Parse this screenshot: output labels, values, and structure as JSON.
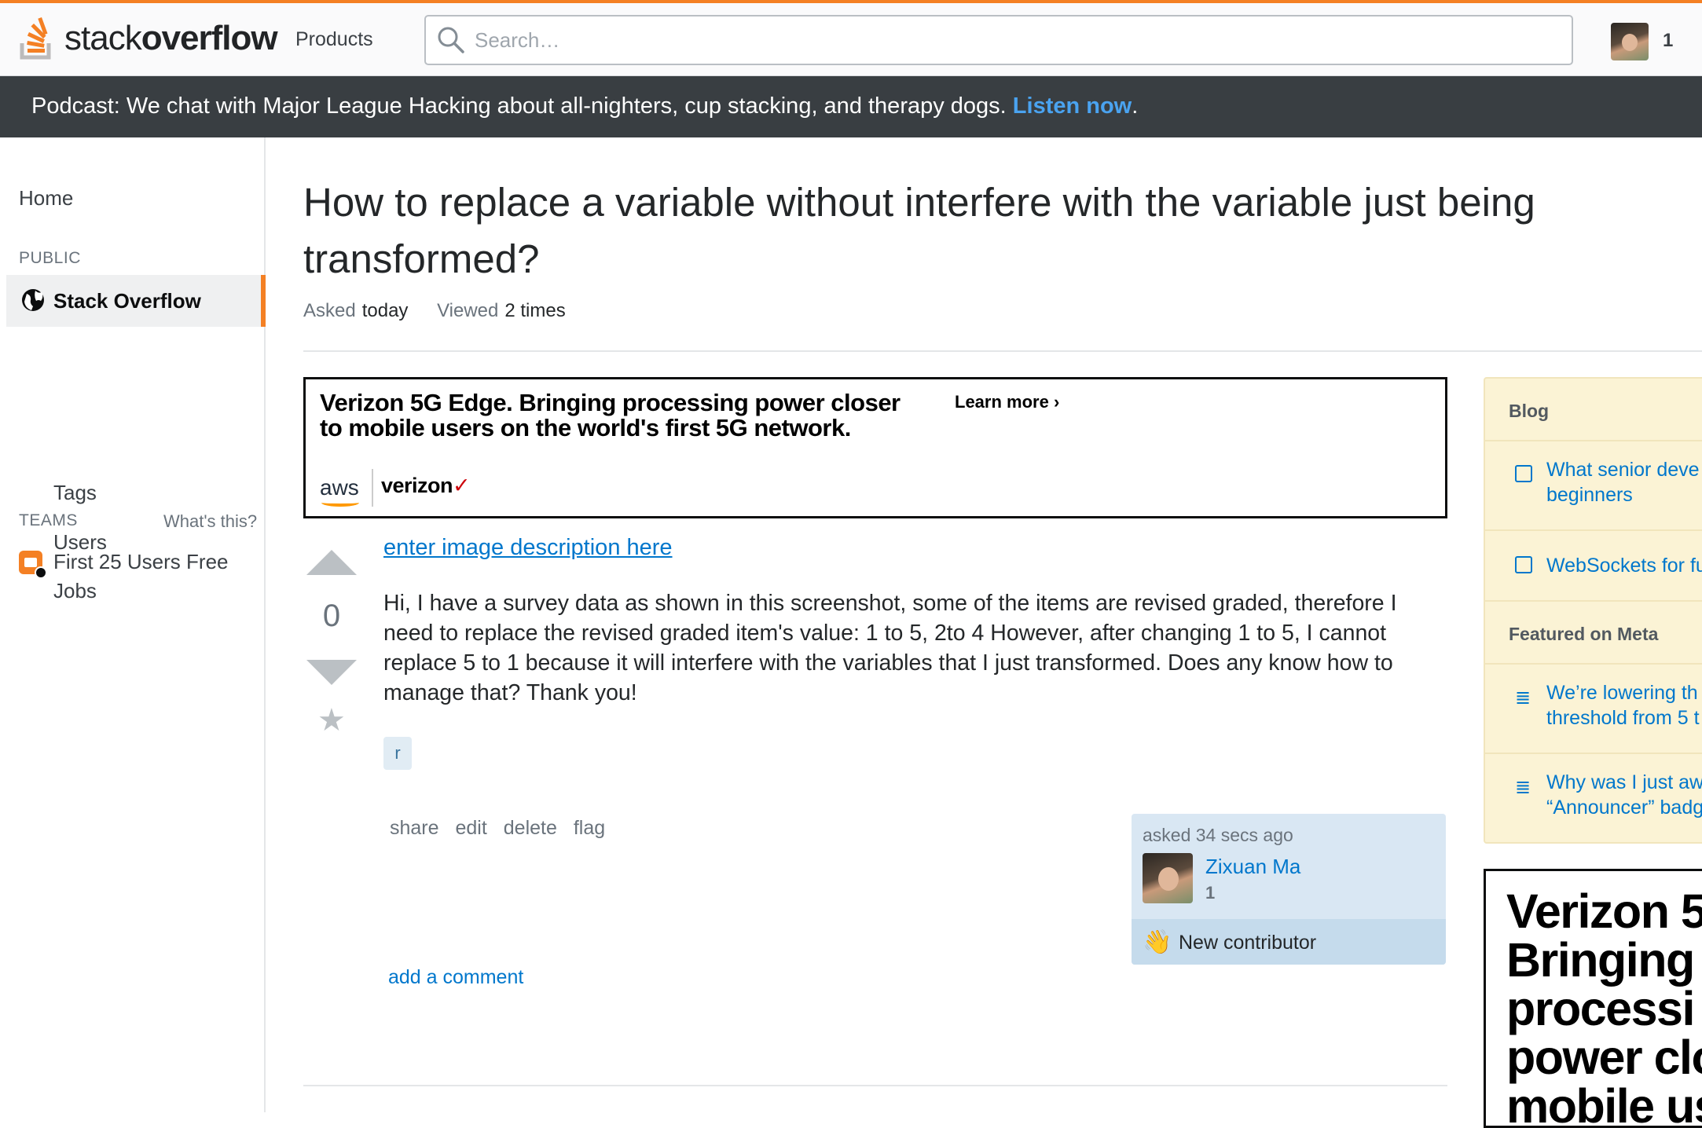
{
  "header": {
    "logo_light": "stack",
    "logo_bold": "overflow",
    "products_label": "Products",
    "search_placeholder": "Search…",
    "reputation": "1"
  },
  "banner": {
    "text": "Podcast: We chat with Major League Hacking about all-nighters, cup stacking, and therapy dogs. ",
    "link_label": "Listen now",
    "trail": "."
  },
  "leftnav": {
    "home": "Home",
    "public_label": "PUBLIC",
    "stack_overflow": "Stack Overflow",
    "tags": "Tags",
    "users": "Users",
    "jobs": "Jobs",
    "teams_label": "TEAMS",
    "whats_this": "What's this?",
    "first_free": "First 25 Users Free"
  },
  "question": {
    "title": "How to replace a variable without interfere with the variable just being transformed?",
    "asked_label": "Asked",
    "asked_value": "today",
    "viewed_label": "Viewed",
    "viewed_value": "2 times",
    "votes": "0",
    "image_link": "enter image description here",
    "body": "Hi, I have a survey data as shown in this screenshot, some of the items are revised graded, therefore I need to replace the revised graded item's value: 1 to 5, 2to 4 However, after changing 1 to 5, I cannot replace 5 to 1 because it will interfere with the variables that I just transformed. Does any know how to manage that? Thank you!",
    "tags": [
      "r"
    ],
    "menu": [
      "share",
      "edit",
      "delete",
      "flag"
    ],
    "add_comment": "add a comment"
  },
  "owner": {
    "asked_time": "asked 34 secs ago",
    "name": "Zixuan Ma",
    "reputation": "1",
    "badge": "New contributor"
  },
  "ad_top": {
    "headline_line1": "Verizon 5G Edge. Bringing processing power closer",
    "headline_line2": "to mobile users on the world's first 5G network.",
    "learn_more": "Learn more",
    "aws": "aws",
    "verizon": "verizon",
    "verizon_check": "✓"
  },
  "sidebar": {
    "blog_header": "Blog",
    "blog_items": [
      {
        "line1": "What senior deve",
        "line2": "beginners"
      },
      {
        "line1": "WebSockets for fu",
        "line2": ""
      }
    ],
    "meta_header": "Featured on Meta",
    "meta_items": [
      {
        "line1": "We’re lowering th",
        "line2": "threshold from 5 t"
      },
      {
        "line1": "Why was I just aw",
        "line2": "“Announcer” badg"
      }
    ],
    "ad_text": [
      "Verizon 5",
      "Bringing",
      "processi",
      "power clo",
      "mobile us"
    ]
  },
  "colors": {
    "accent": "#f48024",
    "link": "#0077cc",
    "banner_bg": "#393e42",
    "blog_bg": "#fbf3d5"
  }
}
